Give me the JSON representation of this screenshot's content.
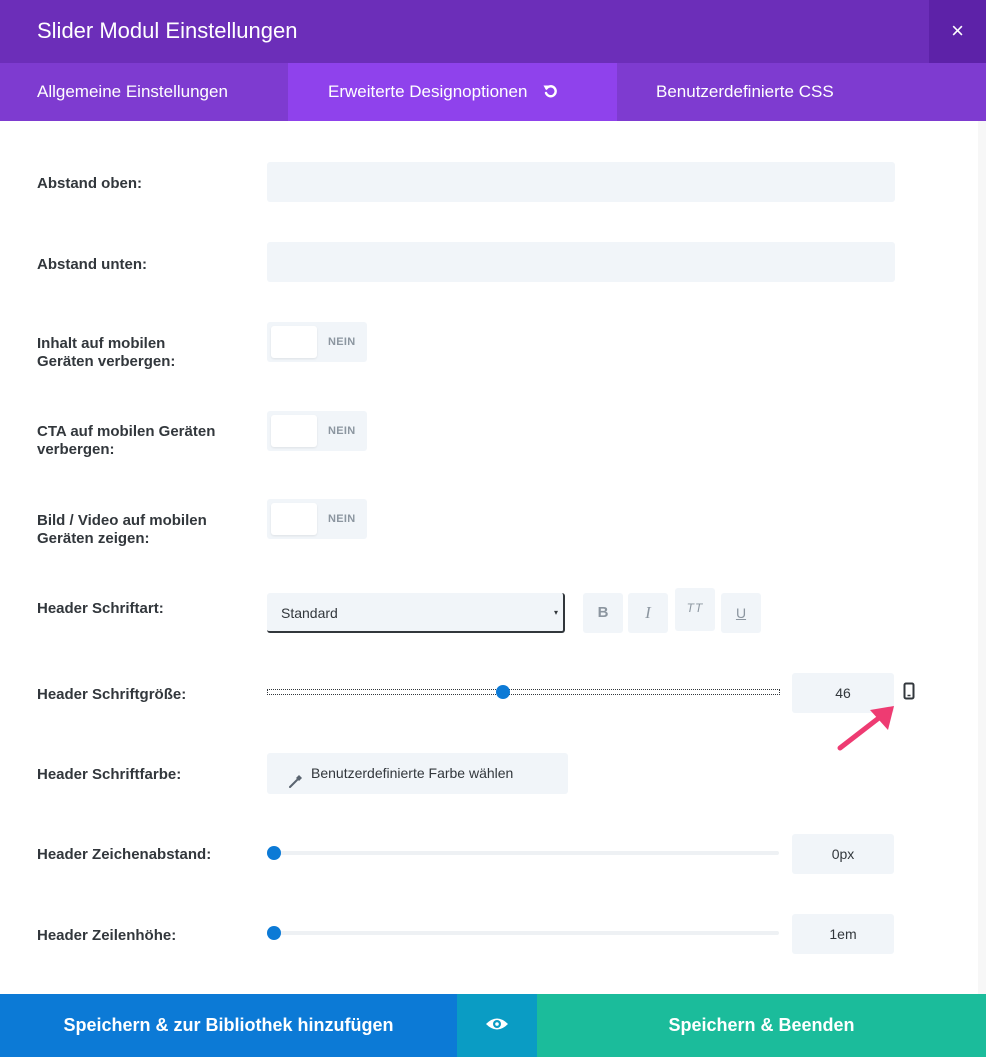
{
  "modal": {
    "title": "Slider Modul Einstellungen",
    "close_icon": "×"
  },
  "tabs": [
    {
      "label": "Allgemeine Einstellungen",
      "active": false
    },
    {
      "label": "Erweiterte Designoptionen",
      "active": true,
      "icon": "reset-icon"
    },
    {
      "label": "Benutzerdefinierte CSS",
      "active": false
    }
  ],
  "fields": {
    "margin_top": {
      "label": "Abstand oben:",
      "value": ""
    },
    "margin_bottom": {
      "label": "Abstand unten:",
      "value": ""
    },
    "hide_content_mobile": {
      "label": "Inhalt auf mobilen Geräten verbergen:",
      "state": "NEIN"
    },
    "hide_cta_mobile": {
      "label": "CTA auf mobilen Geräten verbergen:",
      "state": "NEIN"
    },
    "show_media_mobile": {
      "label": "Bild / Video auf mobilen Geräten zeigen:",
      "state": "NEIN"
    },
    "header_font": {
      "label": "Header Schriftart:",
      "selected": "Standard",
      "format_buttons": {
        "bold": "B",
        "italic": "I",
        "caps": "TT",
        "underline": "U"
      }
    },
    "header_font_size": {
      "label": "Header Schriftgröße:",
      "value": "46",
      "slider_fraction": 0.46,
      "device_icon": "mobile-phone-icon"
    },
    "header_font_color": {
      "label": "Header Schriftfarbe:",
      "button_label": "Benutzerdefinierte Farbe wählen",
      "icon": "eyedropper-icon"
    },
    "header_letter_spacing": {
      "label": "Header Zeichenabstand:",
      "value": "0px",
      "slider_fraction": 0
    },
    "header_line_height": {
      "label": "Header Zeilenhöhe:",
      "value": "1em",
      "slider_fraction": 0
    }
  },
  "footer": {
    "save_library": "Speichern & zur Bibliothek hinzufügen",
    "preview_icon": "eye-icon",
    "save_exit": "Speichern & Beenden"
  },
  "colors": {
    "titlebar": "#6c2eb9",
    "tabs": "#7e3bd0",
    "active_tab": "#8f42ec",
    "primary_blue": "#0c7ad6",
    "preview_teal": "#0a9cc4",
    "save_green": "#1bbc9b",
    "annotation_arrow": "#ee3b72"
  }
}
